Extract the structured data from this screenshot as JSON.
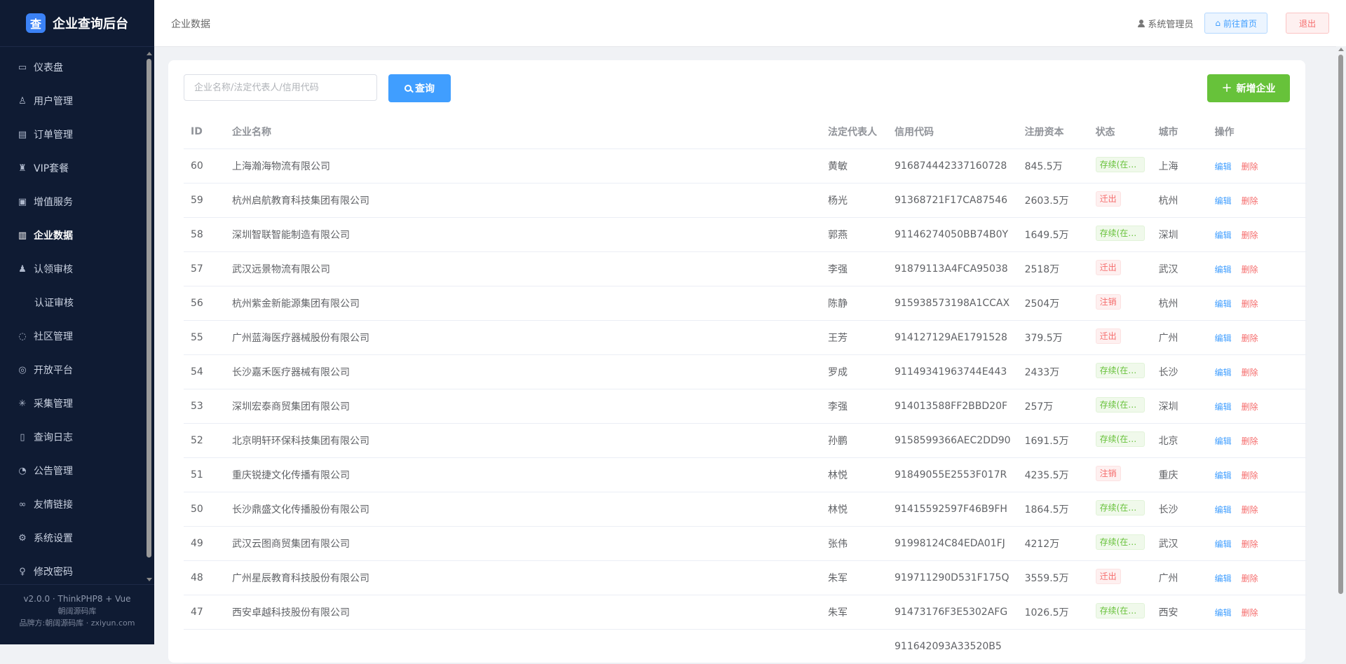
{
  "brand": {
    "logo_char": "查",
    "title": "企业查询后台"
  },
  "sidebar": {
    "items": [
      {
        "label": "仪表盘",
        "icon": "dashboard-icon",
        "glyph": "▭"
      },
      {
        "label": "用户管理",
        "icon": "user-icon",
        "glyph": "♙"
      },
      {
        "label": "订单管理",
        "icon": "clipboard-icon",
        "glyph": "▤"
      },
      {
        "label": "VIP套餐",
        "icon": "medal-icon",
        "glyph": "♜"
      },
      {
        "label": "增值服务",
        "icon": "gift-icon",
        "glyph": "▣"
      },
      {
        "label": "企业数据",
        "icon": "building-icon",
        "glyph": "▥",
        "active": true
      },
      {
        "label": "认领审核",
        "icon": "user-check-icon",
        "glyph": "♟"
      },
      {
        "label": "认证审核",
        "icon": "",
        "glyph": "",
        "sub": true
      },
      {
        "label": "社区管理",
        "icon": "chat-icon",
        "glyph": "◌"
      },
      {
        "label": "开放平台",
        "icon": "database-icon",
        "glyph": "◎"
      },
      {
        "label": "采集管理",
        "icon": "loading-icon",
        "glyph": "✳"
      },
      {
        "label": "查询日志",
        "icon": "document-icon",
        "glyph": "▯"
      },
      {
        "label": "公告管理",
        "icon": "bell-icon",
        "glyph": "◔"
      },
      {
        "label": "友情链接",
        "icon": "link-icon",
        "glyph": "∞"
      },
      {
        "label": "系统设置",
        "icon": "gear-icon",
        "glyph": "⚙"
      },
      {
        "label": "修改密码",
        "icon": "key-icon",
        "glyph": "♀"
      }
    ],
    "footer": {
      "version": "v2.0.0 · ThinkPHP8 + Vue",
      "line2": "朝阔源码库",
      "line3": "品牌方:朝阔源码库 · zxiyun.com"
    }
  },
  "header": {
    "breadcrumb": "企业数据",
    "user": "系统管理员",
    "home_button": "前往首页",
    "logout_button": "退出"
  },
  "toolbar": {
    "search_placeholder": "企业名称/法定代表人/信用代码",
    "search_value": "",
    "search_button": "查询",
    "add_button": "新增企业"
  },
  "table": {
    "columns": [
      "ID",
      "企业名称",
      "法定代表人",
      "信用代码",
      "注册资本",
      "状态",
      "城市",
      "操作"
    ],
    "edit_label": "编辑",
    "delete_label": "删除",
    "rows": [
      {
        "id": "60",
        "name": "上海瀚海物流有限公司",
        "legal": "黄敏",
        "code": "916874442337160728",
        "capital": "845.5万",
        "status": "存续(在营、",
        "status_type": "ok",
        "city": "上海"
      },
      {
        "id": "59",
        "name": "杭州启航教育科技集团有限公司",
        "legal": "杨光",
        "code": "91368721F17CA87546",
        "capital": "2603.5万",
        "status": "迁出",
        "status_type": "bad",
        "city": "杭州"
      },
      {
        "id": "58",
        "name": "深圳智联智能制造有限公司",
        "legal": "郭燕",
        "code": "91146274050BB74B0Y",
        "capital": "1649.5万",
        "status": "存续(在营、",
        "status_type": "ok",
        "city": "深圳"
      },
      {
        "id": "57",
        "name": "武汉远景物流有限公司",
        "legal": "李强",
        "code": "91879113A4FCA95038",
        "capital": "2518万",
        "status": "迁出",
        "status_type": "bad",
        "city": "武汉"
      },
      {
        "id": "56",
        "name": "杭州紫金新能源集团有限公司",
        "legal": "陈静",
        "code": "915938573198A1CCAX",
        "capital": "2504万",
        "status": "注销",
        "status_type": "bad",
        "city": "杭州"
      },
      {
        "id": "55",
        "name": "广州蓝海医疗器械股份有限公司",
        "legal": "王芳",
        "code": "914127129AE1791528",
        "capital": "379.5万",
        "status": "迁出",
        "status_type": "bad",
        "city": "广州"
      },
      {
        "id": "54",
        "name": "长沙嘉禾医疗器械有限公司",
        "legal": "罗成",
        "code": "91149341963744E443",
        "capital": "2433万",
        "status": "存续(在营、",
        "status_type": "ok",
        "city": "长沙"
      },
      {
        "id": "53",
        "name": "深圳宏泰商贸集团有限公司",
        "legal": "李强",
        "code": "914013588FF2BBD20F",
        "capital": "257万",
        "status": "存续(在营、",
        "status_type": "ok",
        "city": "深圳"
      },
      {
        "id": "52",
        "name": "北京明轩环保科技集团有限公司",
        "legal": "孙鹏",
        "code": "9158599366AEC2DD90",
        "capital": "1691.5万",
        "status": "存续(在营、",
        "status_type": "ok",
        "city": "北京"
      },
      {
        "id": "51",
        "name": "重庆锐捷文化传播有限公司",
        "legal": "林悦",
        "code": "91849055E2553F017R",
        "capital": "4235.5万",
        "status": "注销",
        "status_type": "bad",
        "city": "重庆"
      },
      {
        "id": "50",
        "name": "长沙鼎盛文化传播股份有限公司",
        "legal": "林悦",
        "code": "91415592597F46B9FH",
        "capital": "1864.5万",
        "status": "存续(在营、",
        "status_type": "ok",
        "city": "长沙"
      },
      {
        "id": "49",
        "name": "武汉云图商贸集团有限公司",
        "legal": "张伟",
        "code": "91998124C84EDA01FJ",
        "capital": "4212万",
        "status": "存续(在营、",
        "status_type": "ok",
        "city": "武汉"
      },
      {
        "id": "48",
        "name": "广州星辰教育科技股份有限公司",
        "legal": "朱军",
        "code": "919711290D531F175Q",
        "capital": "3559.5万",
        "status": "迁出",
        "status_type": "bad",
        "city": "广州"
      },
      {
        "id": "47",
        "name": "西安卓越科技股份有限公司",
        "legal": "朱军",
        "code": "91473176F3E5302AFG",
        "capital": "1026.5万",
        "status": "存续(在营、",
        "status_type": "ok",
        "city": "西安"
      },
      {
        "id": "",
        "name": "",
        "legal": "",
        "code": "911642093A33520B5",
        "capital": "",
        "status": "",
        "status_type": "bad",
        "city": ""
      }
    ]
  }
}
